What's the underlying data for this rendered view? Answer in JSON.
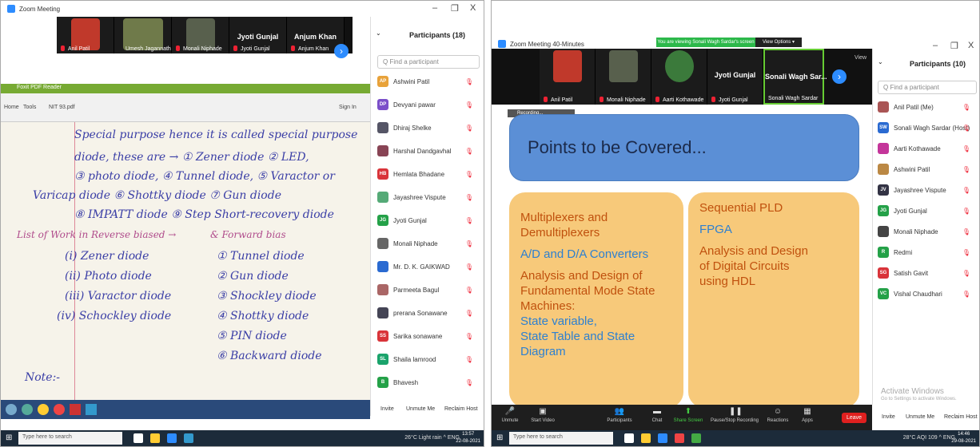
{
  "left": {
    "title": "Zoom Meeting",
    "win_controls": [
      "–",
      "❐",
      "X"
    ],
    "tiles": [
      {
        "name": "Anil Patil"
      },
      {
        "name": "Umesh Jagannath Tupe"
      },
      {
        "name": "Monali Niphade"
      },
      {
        "name": "Jyoti Gunjal",
        "big": "Jyoti Gunjal"
      },
      {
        "name": "Anjum Khan",
        "big": "Anjum Khan"
      }
    ],
    "reader": {
      "title": "Foxit PDF Reader",
      "menu": [
        "Home",
        "Tools",
        "NIT 93.pdf"
      ],
      "signin": "Sign In"
    },
    "notes": [
      "Special purpose hence it is called special purpose",
      "diode, these are → ① Zener diode ② LED,",
      "③ photo diode, ④ Tunnel diode, ⑤ Varactor or",
      "Varicap diode ⑥ Shottky diode ⑦ Gun diode",
      "⑧ IMPATT diode ⑨ Step Short-recovery diode",
      "List of Work in Reverse biased →",
      "& Forward bias",
      "(i) Zener diode",
      "(ii) Photo diode",
      "(iii) Varactor diode",
      "(iv) Schockley diode",
      "① Tunnel diode",
      "② Gun diode",
      "③ Shockley diode",
      "④ Shottky diode",
      "⑤ PIN diode",
      "⑥ Backward diode",
      "Note:-"
    ],
    "participants": {
      "header": "Participants (18)",
      "search_placeholder": "Q Find a participant",
      "list": [
        {
          "initials": "AP",
          "name": "Ashwini Patil",
          "color": "#e8a23a"
        },
        {
          "initials": "DP",
          "name": "Devyani pawar",
          "color": "#7b4fc9"
        },
        {
          "initials": "",
          "name": "Dhiraj Shelke",
          "color": "#556"
        },
        {
          "initials": "",
          "name": "Harshal Dandgavhal",
          "color": "#845"
        },
        {
          "initials": "HB",
          "name": "Hemlata Bhadane",
          "color": "#d9343a"
        },
        {
          "initials": "",
          "name": "Jayashree Vispute",
          "color": "#5a7"
        },
        {
          "initials": "JG",
          "name": "Jyoti Gunjal",
          "color": "#24a148"
        },
        {
          "initials": "",
          "name": "Monali Niphade",
          "color": "#666"
        },
        {
          "initials": "",
          "name": "Mr. D. K. GAIKWAD",
          "color": "#2a6ad1"
        },
        {
          "initials": "",
          "name": "Parmeeta Bagul",
          "color": "#a66"
        },
        {
          "initials": "",
          "name": "prerana Sonawane",
          "color": "#445"
        },
        {
          "initials": "SS",
          "name": "Sarika sonawane",
          "color": "#d9343a"
        },
        {
          "initials": "SL",
          "name": "Shaila lamrood",
          "color": "#1aa36b"
        },
        {
          "initials": "B",
          "name": "Bhavesh",
          "color": "#24a148"
        }
      ],
      "buttons": [
        "Invite",
        "Unmute Me",
        "Reclaim Host"
      ]
    },
    "taskbar": {
      "search": "Type here to search",
      "tray": "26°C Light rain  ^  ENG",
      "time": "13:57",
      "date": "22-08-2021"
    }
  },
  "right": {
    "title": "Zoom Meeting 40-Minutes",
    "banner": "You are viewing Sonali Wagh Sardar's screen",
    "view_options": "View Options ▾",
    "view": "View",
    "win_controls": [
      "–",
      "❐",
      "X"
    ],
    "tiles": [
      {
        "name": "Anil Patil"
      },
      {
        "name": "Monali Niphade"
      },
      {
        "name": "Aarti Kothawade"
      },
      {
        "name": "Jyoti Gunjal",
        "big": "Jyoti Gunjal"
      },
      {
        "name": "Sonali Wagh Sardar",
        "big": "Sonali Wagh Sar..."
      }
    ],
    "recording": "Recording...",
    "slide": {
      "title": "Points to be Covered...",
      "left_items": [
        {
          "text": "Multiplexers and",
          "cls": ""
        },
        {
          "text": "Demultiplexers",
          "cls": ""
        },
        {
          "text": "A/D and D/A Converters",
          "cls": "blue"
        },
        {
          "text": "Analysis and Design of",
          "cls": ""
        },
        {
          "text": "Fundamental Mode State",
          "cls": ""
        },
        {
          "text": "Machines:",
          "cls": ""
        },
        {
          "text": "State variable,",
          "cls": "blue"
        },
        {
          "text": "State Table and State",
          "cls": "blue"
        },
        {
          "text": "Diagram",
          "cls": "blue"
        }
      ],
      "right_items": [
        {
          "text": "Sequential PLD",
          "cls": ""
        },
        {
          "text": "FPGA",
          "cls": "blue"
        },
        {
          "text": "Analysis and Design",
          "cls": ""
        },
        {
          "text": "of Digital Circuits",
          "cls": ""
        },
        {
          "text": "using HDL",
          "cls": ""
        }
      ]
    },
    "participants": {
      "header": "Participants (10)",
      "search_placeholder": "Q Find a participant",
      "list": [
        {
          "initials": "",
          "name": "Anil Patil (Me)",
          "color": "#a55"
        },
        {
          "initials": "SW",
          "name": "Sonali Wagh Sardar (Host)",
          "color": "#2a6ad1"
        },
        {
          "initials": "",
          "name": "Aarti Kothawade",
          "color": "#c4359a"
        },
        {
          "initials": "",
          "name": "Ashwini Patil",
          "color": "#b84"
        },
        {
          "initials": "JV",
          "name": "Jayashree Vispute",
          "color": "#334"
        },
        {
          "initials": "JG",
          "name": "Jyoti Gunjal",
          "color": "#24a148"
        },
        {
          "initials": "",
          "name": "Monali Niphade",
          "color": "#444"
        },
        {
          "initials": "R",
          "name": "Redmi",
          "color": "#24a148"
        },
        {
          "initials": "SG",
          "name": "Satish Gavit",
          "color": "#d9343a"
        },
        {
          "initials": "VC",
          "name": "Vishal Chaudhari",
          "color": "#24a148"
        }
      ],
      "activate": "Activate Windows",
      "activate_sub": "Go to Settings to activate Windows.",
      "buttons": [
        "Invite",
        "Unmute Me",
        "Reclaim Host"
      ]
    },
    "toolbar": [
      {
        "label": "Unmute",
        "icon": "🎤"
      },
      {
        "label": "Start Video",
        "icon": "▣"
      },
      {
        "label": "Participants",
        "icon": "👥"
      },
      {
        "label": "Chat",
        "icon": "▬"
      },
      {
        "label": "Share Screen",
        "icon": "⬆"
      },
      {
        "label": "Pause/Stop Recording",
        "icon": "❚❚"
      },
      {
        "label": "Reactions",
        "icon": "☺"
      },
      {
        "label": "Apps",
        "icon": "▦"
      }
    ],
    "leave": "Leave",
    "taskbar": {
      "search": "Type here to search",
      "tray": "28°C AQI 109  ^  ENG",
      "time": "14:46",
      "date": "29-08-2021"
    }
  }
}
